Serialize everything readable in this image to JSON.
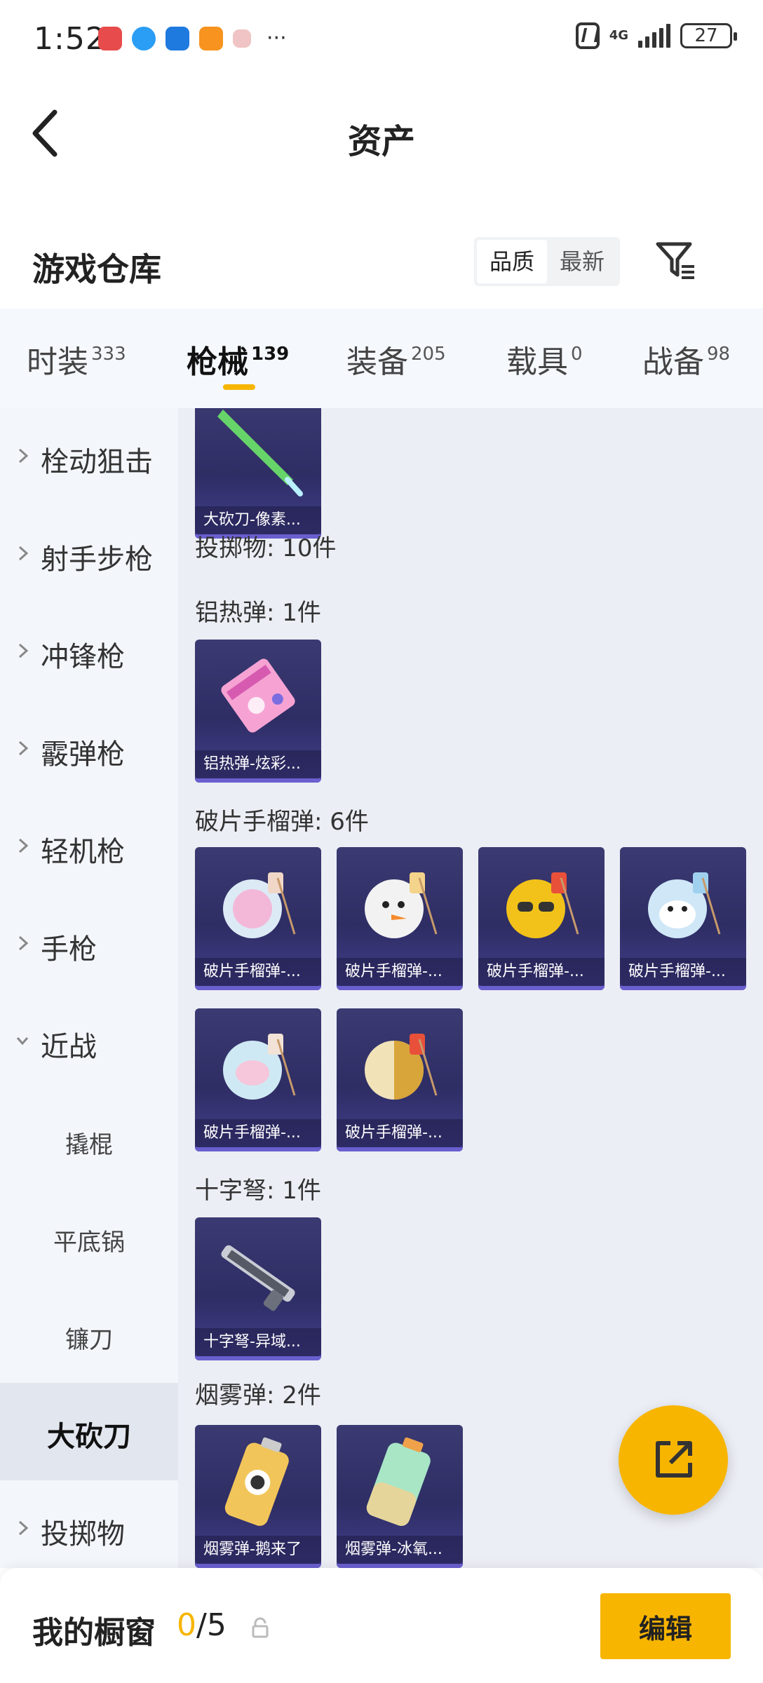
{
  "status_bar": {
    "time": "1:52",
    "network": "4G",
    "battery": "27"
  },
  "header": {
    "title": "资产"
  },
  "section": {
    "title": "游戏仓库",
    "sort_options": [
      "品质",
      "最新"
    ],
    "sort_selected": "品质"
  },
  "tabs": [
    {
      "label": "时装",
      "count": "333"
    },
    {
      "label": "枪械",
      "count": "139",
      "active": true
    },
    {
      "label": "装备",
      "count": "205"
    },
    {
      "label": "载具",
      "count": "0"
    },
    {
      "label": "战备",
      "count": "98"
    }
  ],
  "sidebar": {
    "items": [
      {
        "label": "栓动狙击",
        "type": "category"
      },
      {
        "label": "射手步枪",
        "type": "category"
      },
      {
        "label": "冲锋枪",
        "type": "category"
      },
      {
        "label": "霰弹枪",
        "type": "category"
      },
      {
        "label": "轻机枪",
        "type": "category"
      },
      {
        "label": "手枪",
        "type": "category"
      },
      {
        "label": "近战",
        "type": "category-expanded"
      },
      {
        "label": "撬棍",
        "type": "sub"
      },
      {
        "label": "平底锅",
        "type": "sub"
      },
      {
        "label": "镰刀",
        "type": "sub"
      },
      {
        "label": "大砍刀",
        "type": "sub-selected"
      },
      {
        "label": "投掷物",
        "type": "category"
      }
    ]
  },
  "content": {
    "top_item": {
      "name": "大砍刀-像素..."
    },
    "throwables_title": "投掷物: 10件",
    "groups": [
      {
        "title": "铝热弹: 1件",
        "items": [
          {
            "name": "铝热弹-炫彩..."
          }
        ]
      },
      {
        "title": "破片手榴弹: 6件",
        "items": [
          {
            "name": "破片手榴弹-..."
          },
          {
            "name": "破片手榴弹-..."
          },
          {
            "name": "破片手榴弹-..."
          },
          {
            "name": "破片手榴弹-..."
          },
          {
            "name": "破片手榴弹-..."
          },
          {
            "name": "破片手榴弹-..."
          }
        ]
      },
      {
        "title": "十字弩: 1件",
        "items": [
          {
            "name": "十字弩-异域..."
          }
        ]
      },
      {
        "title": "烟雾弹: 2件",
        "items": [
          {
            "name": "烟雾弹-鹅来了"
          },
          {
            "name": "烟雾弹-冰氧..."
          }
        ]
      }
    ]
  },
  "bottom_bar": {
    "label": "我的橱窗",
    "current": "0",
    "total": "/5",
    "edit_label": "编辑"
  },
  "colors": {
    "accent": "#f7b500",
    "card_bg": "#2e2d64",
    "sidebar_bg": "#f3f6fb",
    "content_bg": "#ebeef4"
  },
  "icons": {
    "back": "chevron-left-icon",
    "filter": "filter-icon",
    "share": "external-link-icon",
    "lock": "lock-icon"
  }
}
